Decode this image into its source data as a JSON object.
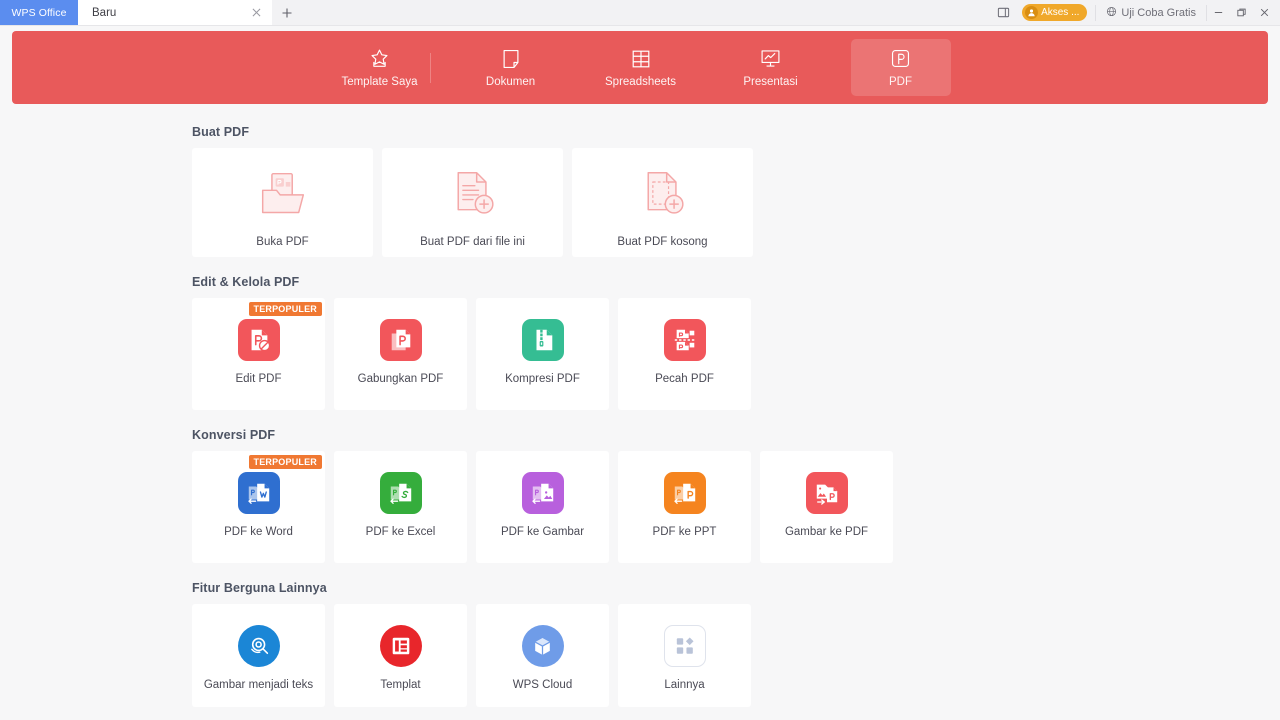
{
  "titlebar": {
    "logo": "WPS Office",
    "tab_label": "Baru",
    "close_tab_icon": "close-icon",
    "new_tab_icon": "plus-icon",
    "sidebar_toggle_icon": "panel-icon",
    "account_label": "Akses ...",
    "account_icon": "user-avatar-icon",
    "trial_label": "Uji Coba Gratis",
    "trial_icon": "globe-icon",
    "minimize_icon": "minimize-icon",
    "restore_icon": "restore-icon",
    "close_icon": "close-icon"
  },
  "navbar": {
    "accent_color": "#e85a5a",
    "items": [
      {
        "label": "Template Saya",
        "icon": "star-template-icon",
        "active": false
      },
      {
        "label": "Dokumen",
        "icon": "document-icon",
        "active": false
      },
      {
        "label": "Spreadsheets",
        "icon": "table-icon",
        "active": false
      },
      {
        "label": "Presentasi",
        "icon": "presentation-icon",
        "active": false
      },
      {
        "label": "PDF",
        "icon": "pdf-icon",
        "active": true
      }
    ]
  },
  "sections": [
    {
      "title": "Buat PDF",
      "cards": [
        {
          "label": "Buka PDF",
          "icon": "open-pdf-folder-icon",
          "style": "outline"
        },
        {
          "label": "Buat PDF dari file ini",
          "icon": "pdf-from-file-icon",
          "style": "outline"
        },
        {
          "label": "Buat PDF kosong",
          "icon": "blank-pdf-icon",
          "style": "outline"
        }
      ]
    },
    {
      "title": "Edit & Kelola PDF",
      "cards": [
        {
          "label": "Edit PDF",
          "icon": "edit-pdf-icon",
          "color": "#f2565b",
          "badge": "TERPOPULER"
        },
        {
          "label": "Gabungkan PDF",
          "icon": "merge-pdf-icon",
          "color": "#f2565b"
        },
        {
          "label": "Kompresi PDF",
          "icon": "compress-pdf-icon",
          "color": "#35bd93"
        },
        {
          "label": "Pecah PDF",
          "icon": "split-pdf-icon",
          "color": "#f2565b"
        }
      ]
    },
    {
      "title": "Konversi PDF",
      "cards": [
        {
          "label": "PDF ke Word",
          "icon": "pdf-to-word-icon",
          "color": "#2f6fd0",
          "badge": "TERPOPULER"
        },
        {
          "label": "PDF ke Excel",
          "icon": "pdf-to-excel-icon",
          "color": "#35ad3c"
        },
        {
          "label": "PDF ke Gambar",
          "icon": "pdf-to-image-icon",
          "color": "#b860dd"
        },
        {
          "label": "PDF ke PPT",
          "icon": "pdf-to-ppt-icon",
          "color": "#f5841f"
        },
        {
          "label": "Gambar ke PDF",
          "icon": "image-to-pdf-icon",
          "color": "#f2565b"
        }
      ]
    },
    {
      "title": "Fitur Berguna Lainnya",
      "cards": [
        {
          "label": "Gambar menjadi teks",
          "icon": "ocr-scan-icon",
          "color": "#1b86d6",
          "shape": "circle"
        },
        {
          "label": "Templat",
          "icon": "template-list-icon",
          "color": "#e8262b",
          "shape": "circle"
        },
        {
          "label": "WPS Cloud",
          "icon": "cloud-cube-icon",
          "color": "#6f9ce8",
          "shape": "circle"
        },
        {
          "label": "Lainnya",
          "icon": "more-grid-icon",
          "color": "#b8c2d6",
          "shape": "outline-tile"
        }
      ]
    }
  ]
}
